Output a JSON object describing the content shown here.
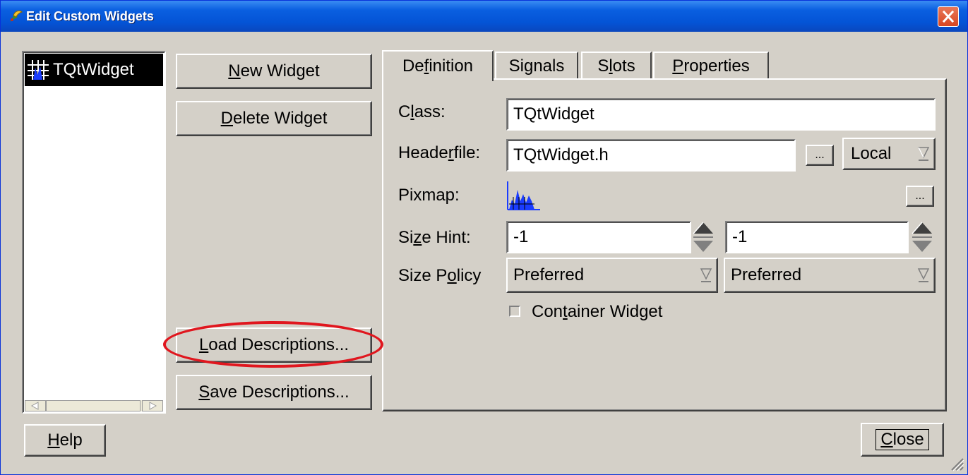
{
  "window": {
    "title": "Edit Custom Widgets"
  },
  "widget_list": {
    "items": [
      "TQtWidget"
    ]
  },
  "actions": {
    "new_widget": "New Widget",
    "delete_widget": "Delete Widget",
    "load_descriptions": "Load Descriptions...",
    "save_descriptions": "Save Descriptions..."
  },
  "tabs": [
    {
      "label": "Definition",
      "mnemonic": "f",
      "active": true
    },
    {
      "label": "Signals",
      "mnemonic": "g",
      "active": false
    },
    {
      "label": "Slots",
      "mnemonic": "l",
      "active": false
    },
    {
      "label": "Properties",
      "mnemonic": "P",
      "active": false
    }
  ],
  "definition": {
    "class_label": "Class:",
    "class_value": "TQtWidget",
    "headerfile_label": "Headerfile:",
    "headerfile_value": "TQtWidget.h",
    "browse_label": "...",
    "include_scope": "Local",
    "pixmap_label": "Pixmap:",
    "pixmap_browse": "...",
    "size_hint_label": "Size Hint:",
    "size_hint_width": "-1",
    "size_hint_height": "-1",
    "size_policy_label": "Size Policy",
    "size_policy_horizontal": "Preferred",
    "size_policy_vertical": "Preferred",
    "container_label": "Container Widget",
    "container_checked": false
  },
  "footer": {
    "help": "Help",
    "close": "Close"
  },
  "colors": {
    "accent_blue": "#0454d6",
    "annotation_red": "#e0161e",
    "face": "#d4d0c8"
  }
}
